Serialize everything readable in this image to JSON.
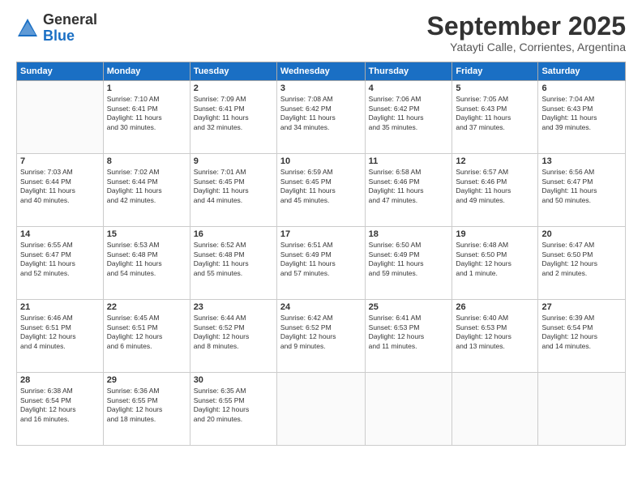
{
  "header": {
    "logo_general": "General",
    "logo_blue": "Blue",
    "month": "September 2025",
    "location": "Yatayti Calle, Corrientes, Argentina"
  },
  "weekdays": [
    "Sunday",
    "Monday",
    "Tuesday",
    "Wednesday",
    "Thursday",
    "Friday",
    "Saturday"
  ],
  "weeks": [
    [
      {
        "day": "",
        "info": ""
      },
      {
        "day": "1",
        "info": "Sunrise: 7:10 AM\nSunset: 6:41 PM\nDaylight: 11 hours\nand 30 minutes."
      },
      {
        "day": "2",
        "info": "Sunrise: 7:09 AM\nSunset: 6:41 PM\nDaylight: 11 hours\nand 32 minutes."
      },
      {
        "day": "3",
        "info": "Sunrise: 7:08 AM\nSunset: 6:42 PM\nDaylight: 11 hours\nand 34 minutes."
      },
      {
        "day": "4",
        "info": "Sunrise: 7:06 AM\nSunset: 6:42 PM\nDaylight: 11 hours\nand 35 minutes."
      },
      {
        "day": "5",
        "info": "Sunrise: 7:05 AM\nSunset: 6:43 PM\nDaylight: 11 hours\nand 37 minutes."
      },
      {
        "day": "6",
        "info": "Sunrise: 7:04 AM\nSunset: 6:43 PM\nDaylight: 11 hours\nand 39 minutes."
      }
    ],
    [
      {
        "day": "7",
        "info": "Sunrise: 7:03 AM\nSunset: 6:44 PM\nDaylight: 11 hours\nand 40 minutes."
      },
      {
        "day": "8",
        "info": "Sunrise: 7:02 AM\nSunset: 6:44 PM\nDaylight: 11 hours\nand 42 minutes."
      },
      {
        "day": "9",
        "info": "Sunrise: 7:01 AM\nSunset: 6:45 PM\nDaylight: 11 hours\nand 44 minutes."
      },
      {
        "day": "10",
        "info": "Sunrise: 6:59 AM\nSunset: 6:45 PM\nDaylight: 11 hours\nand 45 minutes."
      },
      {
        "day": "11",
        "info": "Sunrise: 6:58 AM\nSunset: 6:46 PM\nDaylight: 11 hours\nand 47 minutes."
      },
      {
        "day": "12",
        "info": "Sunrise: 6:57 AM\nSunset: 6:46 PM\nDaylight: 11 hours\nand 49 minutes."
      },
      {
        "day": "13",
        "info": "Sunrise: 6:56 AM\nSunset: 6:47 PM\nDaylight: 11 hours\nand 50 minutes."
      }
    ],
    [
      {
        "day": "14",
        "info": "Sunrise: 6:55 AM\nSunset: 6:47 PM\nDaylight: 11 hours\nand 52 minutes."
      },
      {
        "day": "15",
        "info": "Sunrise: 6:53 AM\nSunset: 6:48 PM\nDaylight: 11 hours\nand 54 minutes."
      },
      {
        "day": "16",
        "info": "Sunrise: 6:52 AM\nSunset: 6:48 PM\nDaylight: 11 hours\nand 55 minutes."
      },
      {
        "day": "17",
        "info": "Sunrise: 6:51 AM\nSunset: 6:49 PM\nDaylight: 11 hours\nand 57 minutes."
      },
      {
        "day": "18",
        "info": "Sunrise: 6:50 AM\nSunset: 6:49 PM\nDaylight: 11 hours\nand 59 minutes."
      },
      {
        "day": "19",
        "info": "Sunrise: 6:48 AM\nSunset: 6:50 PM\nDaylight: 12 hours\nand 1 minute."
      },
      {
        "day": "20",
        "info": "Sunrise: 6:47 AM\nSunset: 6:50 PM\nDaylight: 12 hours\nand 2 minutes."
      }
    ],
    [
      {
        "day": "21",
        "info": "Sunrise: 6:46 AM\nSunset: 6:51 PM\nDaylight: 12 hours\nand 4 minutes."
      },
      {
        "day": "22",
        "info": "Sunrise: 6:45 AM\nSunset: 6:51 PM\nDaylight: 12 hours\nand 6 minutes."
      },
      {
        "day": "23",
        "info": "Sunrise: 6:44 AM\nSunset: 6:52 PM\nDaylight: 12 hours\nand 8 minutes."
      },
      {
        "day": "24",
        "info": "Sunrise: 6:42 AM\nSunset: 6:52 PM\nDaylight: 12 hours\nand 9 minutes."
      },
      {
        "day": "25",
        "info": "Sunrise: 6:41 AM\nSunset: 6:53 PM\nDaylight: 12 hours\nand 11 minutes."
      },
      {
        "day": "26",
        "info": "Sunrise: 6:40 AM\nSunset: 6:53 PM\nDaylight: 12 hours\nand 13 minutes."
      },
      {
        "day": "27",
        "info": "Sunrise: 6:39 AM\nSunset: 6:54 PM\nDaylight: 12 hours\nand 14 minutes."
      }
    ],
    [
      {
        "day": "28",
        "info": "Sunrise: 6:38 AM\nSunset: 6:54 PM\nDaylight: 12 hours\nand 16 minutes."
      },
      {
        "day": "29",
        "info": "Sunrise: 6:36 AM\nSunset: 6:55 PM\nDaylight: 12 hours\nand 18 minutes."
      },
      {
        "day": "30",
        "info": "Sunrise: 6:35 AM\nSunset: 6:55 PM\nDaylight: 12 hours\nand 20 minutes."
      },
      {
        "day": "",
        "info": ""
      },
      {
        "day": "",
        "info": ""
      },
      {
        "day": "",
        "info": ""
      },
      {
        "day": "",
        "info": ""
      }
    ]
  ]
}
